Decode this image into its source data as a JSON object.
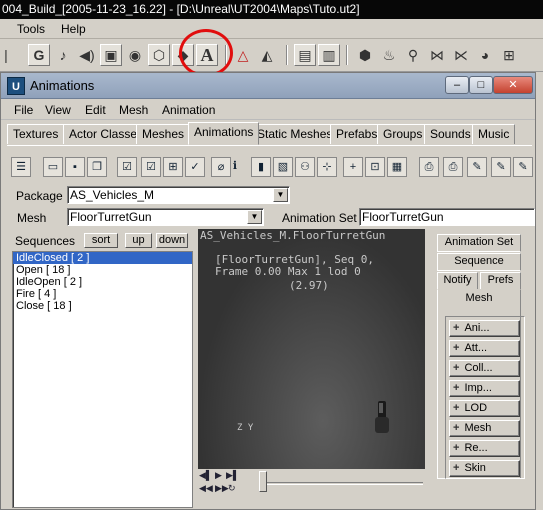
{
  "host": {
    "title": "004_Build_[2005-11-23_16.22] - [D:\\Unreal\\UT2004\\Maps\\Tuto.ut2]",
    "menu": [
      "Tools",
      "Help"
    ],
    "toolbar_letter": "A",
    "highlight_color": "#e10d0d"
  },
  "window": {
    "title": "Animations",
    "icon_letter": "U",
    "controls": [
      "–",
      "□",
      "✕"
    ],
    "menu": [
      "File",
      "View",
      "Edit",
      "Mesh",
      "Animation"
    ],
    "tabs": [
      "Textures",
      "Actor Classes",
      "Meshes",
      "Animations",
      "Static Meshes",
      "Prefabs",
      "Groups",
      "Sounds",
      "Music"
    ],
    "active_tab": "Animations"
  },
  "fields": {
    "package_label": "Package",
    "package_value": "AS_Vehicles_M",
    "mesh_label": "Mesh",
    "mesh_value": "FloorTurretGun",
    "animset_label": "Animation Set",
    "animset_value": "FloorTurretGun"
  },
  "sequences": {
    "label": "Sequences",
    "buttons": [
      "sort",
      "up",
      "down"
    ],
    "items": [
      "IdleClosed [ 2 ]",
      "Open [ 18 ]",
      "IdleOpen [ 2 ]",
      "Fire [ 4 ]",
      "Close [ 18 ]"
    ],
    "selected": 0
  },
  "viewport": {
    "header": "AS_Vehicles_M.FloorTurretGun",
    "info_line1": "[FloorTurretGun], Seq 0,",
    "info_line2": "Frame  0.00 Max 1  lod 0",
    "info_line3": "(2.97)",
    "axis_label": "Z Y"
  },
  "right_panel": {
    "tabs": [
      "Animation Set",
      "Sequence",
      "Notify",
      "Prefs",
      "Mesh"
    ],
    "buttons": [
      "Ani...",
      "Att...",
      "Coll...",
      "Imp...",
      "LOD",
      "Mesh",
      "Re...",
      "Skin"
    ]
  }
}
